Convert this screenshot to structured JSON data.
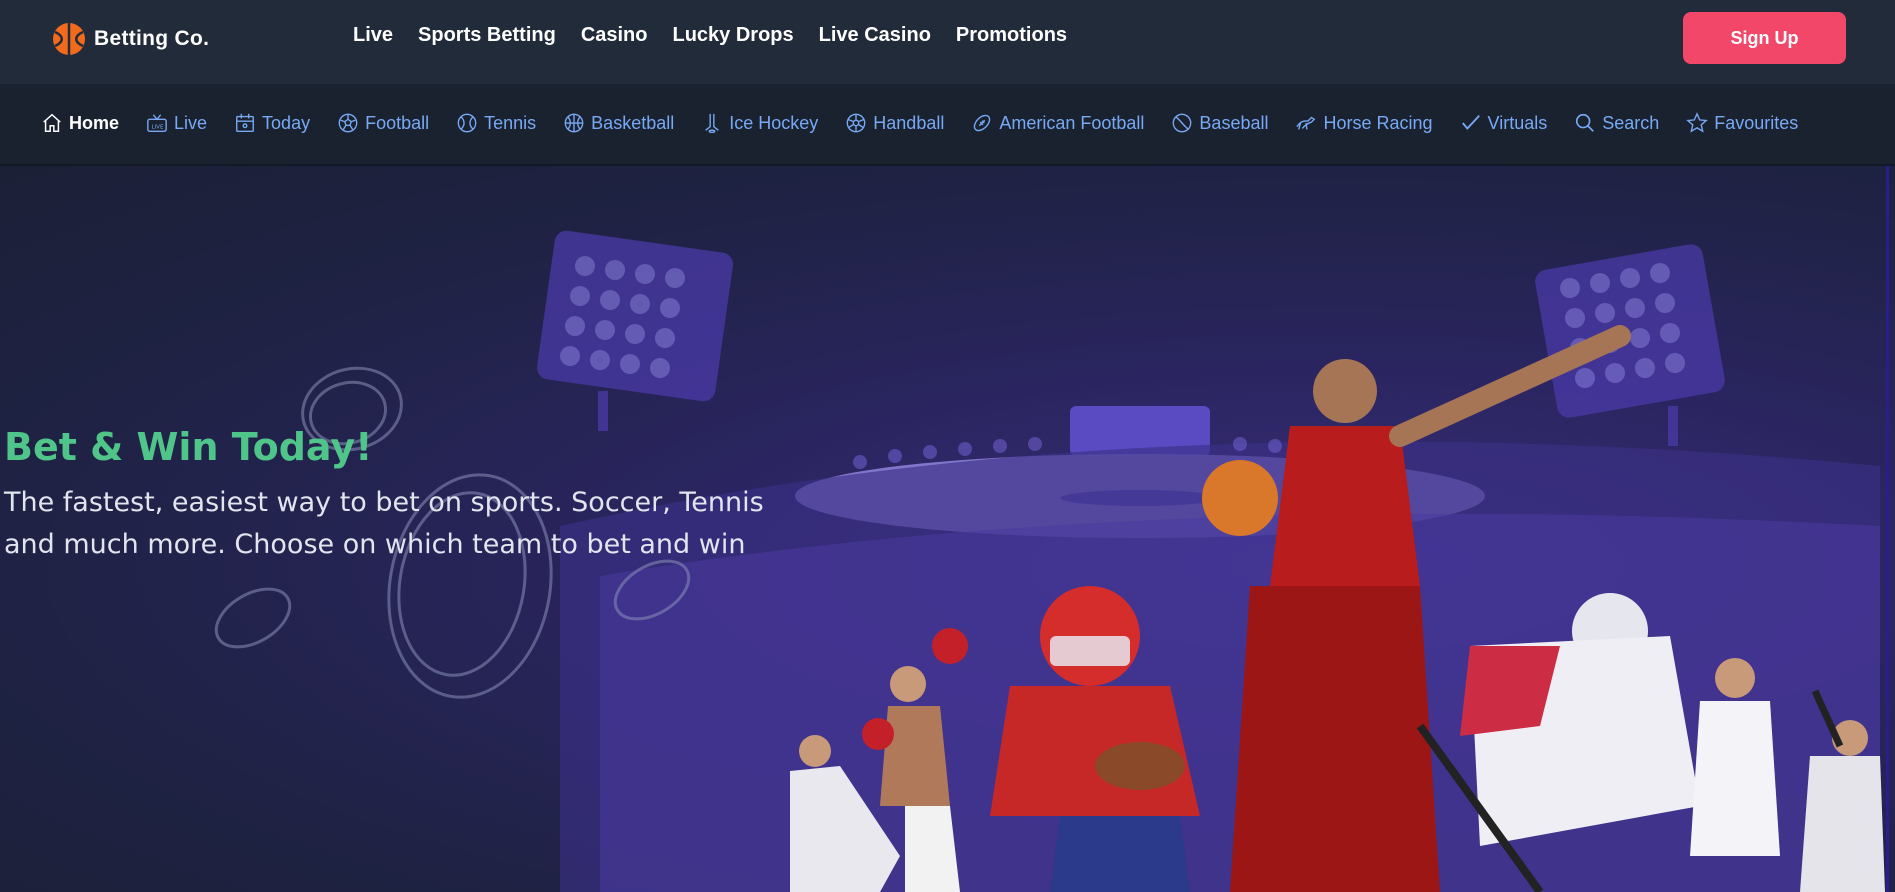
{
  "brand": {
    "name": "Betting Co."
  },
  "main_nav": [
    "Live",
    "Sports Betting",
    "Casino",
    "Lucky Drops",
    "Live Casino",
    "Promotions"
  ],
  "signup": {
    "label": "Sign Up"
  },
  "sub_nav": [
    {
      "label": "Home",
      "icon": "home-icon",
      "active": true
    },
    {
      "label": "Live",
      "icon": "live-tv-icon"
    },
    {
      "label": "Today",
      "icon": "calendar-icon"
    },
    {
      "label": "Football",
      "icon": "football-icon"
    },
    {
      "label": "Tennis",
      "icon": "tennis-icon"
    },
    {
      "label": "Basketball",
      "icon": "basketball-icon"
    },
    {
      "label": "Ice Hockey",
      "icon": "ice-hockey-icon"
    },
    {
      "label": "Handball",
      "icon": "handball-icon"
    },
    {
      "label": "American Football",
      "icon": "american-football-icon"
    },
    {
      "label": "Baseball",
      "icon": "baseball-icon"
    },
    {
      "label": "Horse Racing",
      "icon": "horse-racing-icon"
    },
    {
      "label": "Virtuals",
      "icon": "virtuals-icon"
    },
    {
      "label": "Search",
      "icon": "search-icon"
    },
    {
      "label": "Favourites",
      "icon": "star-icon"
    }
  ],
  "hero": {
    "title": "Bet & Win Today!",
    "text_line1": "The fastest, easiest way to bet on sports. Soccer, Tennis",
    "text_line2": "and much more. Choose on which team to bet and win"
  },
  "colors": {
    "accent": "#f3476a",
    "title_green": "#4fc58a",
    "link_blue": "#78a9f5",
    "topbar": "#222b3a"
  }
}
